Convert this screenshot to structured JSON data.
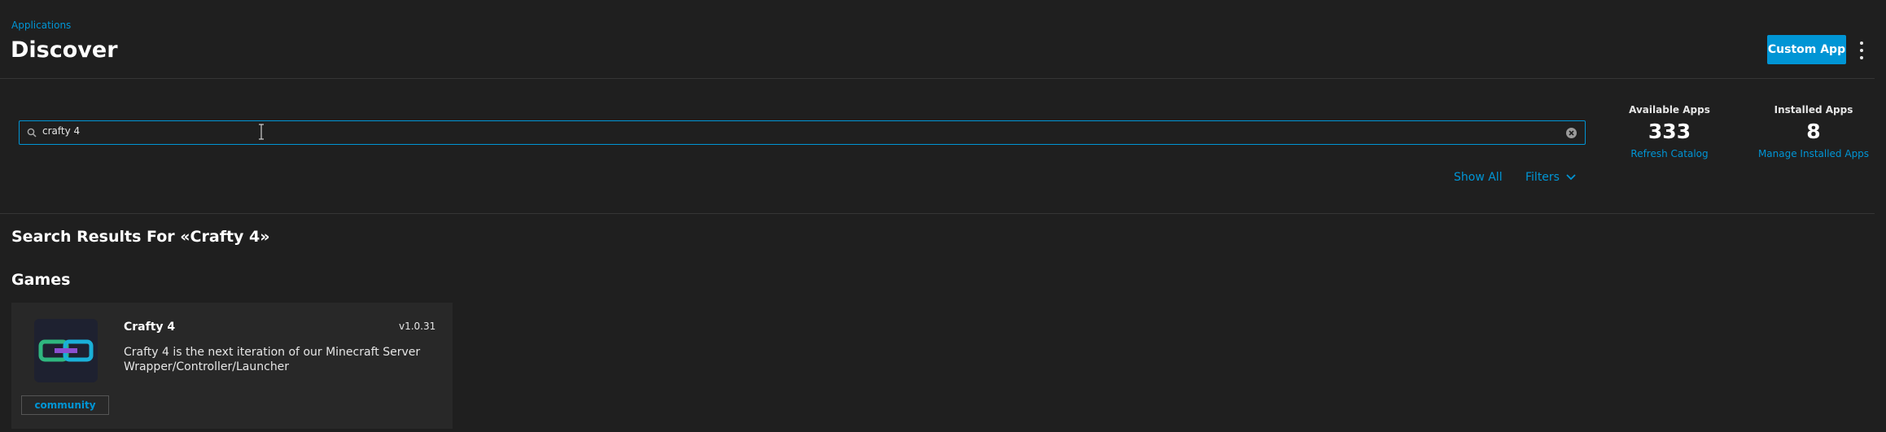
{
  "header": {
    "breadcrumb": "Applications",
    "title": "Discover",
    "custom_app_label": "Custom App"
  },
  "search": {
    "value": "crafty 4"
  },
  "stats": {
    "available": {
      "label": "Available Apps",
      "value": "333",
      "link": "Refresh Catalog"
    },
    "installed": {
      "label": "Installed Apps",
      "value": "8",
      "link": "Manage Installed Apps"
    }
  },
  "controls": {
    "show_all": "Show All",
    "filters": "Filters"
  },
  "results": {
    "heading": "Search Results For «Crafty 4»",
    "category": "Games",
    "apps": [
      {
        "name": "Crafty 4",
        "version": "v1.0.31",
        "description": "Crafty 4 is the next iteration of our Minecraft Server Wrapper/Controller/Launcher",
        "train": "community"
      }
    ]
  },
  "colors": {
    "accent": "#0095d5",
    "background": "#1f1f1f",
    "card": "#282828"
  }
}
